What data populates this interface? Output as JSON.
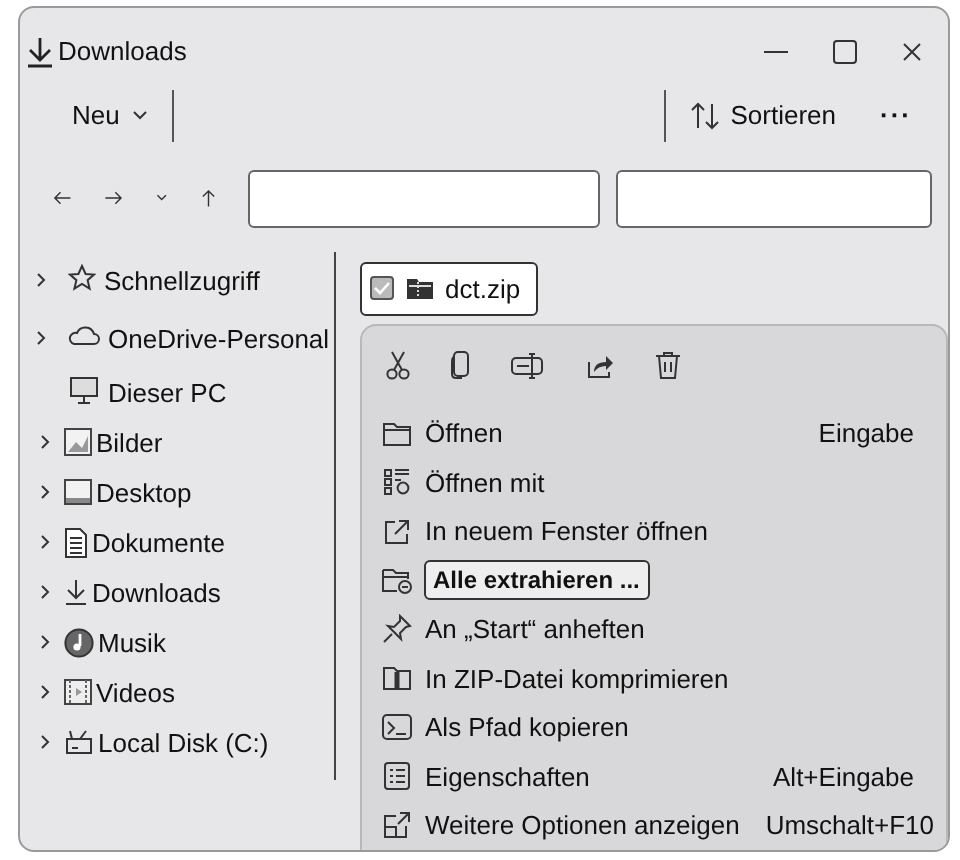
{
  "window": {
    "title": "Downloads"
  },
  "toolbar": {
    "new_label": "Neu",
    "sort_label": "Sortieren",
    "more_label": "···"
  },
  "sidebar": {
    "items": [
      {
        "label": "Schnellzugriff",
        "expandable": true
      },
      {
        "label": "OneDrive-Personal",
        "expandable": true
      },
      {
        "label": "Dieser PC",
        "expandable": false,
        "children": [
          {
            "label": "Bilder",
            "expandable": true
          },
          {
            "label": "Desktop",
            "expandable": true
          },
          {
            "label": "Dokumente",
            "expandable": true
          },
          {
            "label": "Downloads",
            "expandable": true
          },
          {
            "label": "Musik",
            "expandable": true
          },
          {
            "label": "Videos",
            "expandable": true
          },
          {
            "label": "Local Disk (C:)",
            "expandable": true
          }
        ]
      }
    ]
  },
  "files": [
    {
      "name": "dct.zip",
      "checked": true,
      "selected": true
    }
  ],
  "context_menu": {
    "items": [
      {
        "label": "Öffnen",
        "shortcut": "Eingabe",
        "selected": false
      },
      {
        "label": "Öffnen mit",
        "selected": false
      },
      {
        "label": "In neuem Fenster öffnen",
        "selected": false
      },
      {
        "label": "Alle extrahieren ...",
        "selected": true
      },
      {
        "label": "An „Start“ anheften",
        "selected": false
      },
      {
        "label": "In ZIP-Datei komprimieren",
        "selected": false
      },
      {
        "label": "Als Pfad kopieren",
        "selected": false
      },
      {
        "label": "Eigenschaften",
        "shortcut": "Alt+Eingabe",
        "selected": false
      },
      {
        "label": "Weitere Optionen anzeigen",
        "shortcut": "Umschalt+F10",
        "selected": false
      }
    ]
  }
}
